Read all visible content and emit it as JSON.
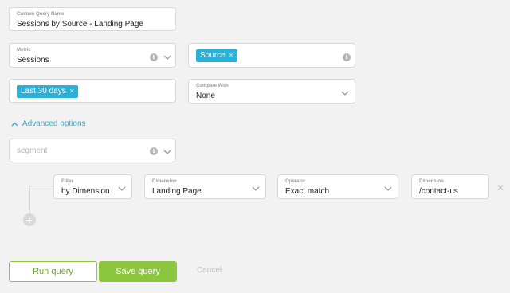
{
  "query_name": {
    "label": "Custom Query Name",
    "value": "Sessions by Source - Landing Page"
  },
  "metric": {
    "label": "Metric",
    "value": "Sessions"
  },
  "dimension_tags": [
    {
      "label": "Source"
    }
  ],
  "date_range": {
    "tag": "Last 30 days"
  },
  "compare_with": {
    "label": "Compare With",
    "value": "None"
  },
  "advanced": {
    "label": "Advanced options"
  },
  "segment": {
    "placeholder": "segment"
  },
  "filter": {
    "filter": {
      "label": "Filter",
      "value": "by Dimension"
    },
    "dimension": {
      "label": "Dimension",
      "value": "Landing Page"
    },
    "operator": {
      "label": "Operator",
      "value": "Exact match"
    },
    "match_value": {
      "label": "Dimension",
      "value": "/contact-us"
    }
  },
  "actions": {
    "run": "Run query",
    "save": "Save query",
    "cancel": "Cancel"
  },
  "icons": {
    "info": "info-icon",
    "chevron": "chevron-down-icon",
    "remove": "close-icon",
    "add": "plus-icon",
    "advanced_toggle": "chevron-up-icon"
  },
  "colors": {
    "accent": "#2bb0d8",
    "primary": "#8cc63f"
  }
}
